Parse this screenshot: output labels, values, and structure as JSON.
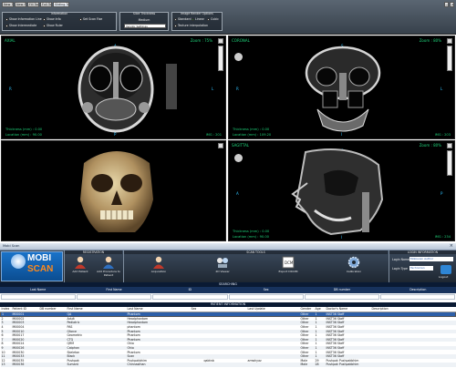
{
  "toolbar": {
    "buttons": [
      "New Tool",
      "New Pos",
      "Fill Tool",
      "Full Tool",
      "Sliding Tool"
    ],
    "information_title": "Information",
    "options": [
      "Show Information Line",
      "Show Info",
      "Set Scan Fixe",
      "Show Intermediate",
      "Show Ruler"
    ],
    "slice_thickness_title": "Slice Thickness",
    "slice_thickness_value": "Medium",
    "slice_thickness_select": "Vendor Settings",
    "image_render_title": "Image Render Options",
    "render_modes": [
      "Standard",
      "Linear",
      "Cubic"
    ],
    "texture_interp": "Texture interpolation"
  },
  "viewports": {
    "axial": {
      "label": "AXIAL",
      "zoom": "Zoom : 75%",
      "thickness": "Thickness (mm) : 0.00",
      "location": "Location (mm) : 90.00",
      "img": "IMG : 201",
      "orient_l": "R",
      "orient_t": "A",
      "orient_b": "P",
      "orient_r": "L"
    },
    "coronal": {
      "label": "CORONAL",
      "zoom": "Zoom : 80%",
      "thickness": "Thickness (mm) : 0.00",
      "location": "Location (mm) : 109.20",
      "img": "IMG : 203",
      "orient_l": "R",
      "orient_t": "S",
      "orient_b": "I",
      "orient_r": "L"
    },
    "sagittal": {
      "label": "SAGITTAL",
      "zoom": "Zoom : 80%",
      "thickness": "Thickness (mm) : 0.00",
      "location": "Location (mm) : 90.00",
      "img": "IMG : 234",
      "orient_l": "A",
      "orient_t": "S",
      "orient_b": "I",
      "orient_r": "P"
    }
  },
  "mobiscan": {
    "title_bar": "Mobi Scan",
    "logo_line1": "MOBI",
    "logo_line2": "SCAN",
    "registration_title": "REGISTRATION",
    "reg_items": [
      "Add Patient",
      "Add Procedure to Patient"
    ],
    "scan_tools_title": "SCAN TOOLS",
    "scan_items": [
      "Acquisition",
      "2D Viewer",
      "Export DICOM",
      "Calibration"
    ],
    "login_title": "LOGIN INFORMATION",
    "login_name_label": "Login Name",
    "login_name_value": "Mobiscan Author",
    "login_type_label": "Login Type",
    "login_type_value": "Technician",
    "logout_label": "Logout",
    "searching_title": "SEARCHING",
    "search_cols": [
      "Last Name",
      "First Name",
      "ID",
      "Sex",
      "DB number",
      "Description"
    ],
    "patient_info_title": "PATIENT INFORMATION",
    "table_headers": [
      "Index",
      "Patient ID",
      "DB number",
      "First Name",
      "Last Name",
      "Sex",
      "",
      "Last Update",
      "Gender",
      "Age",
      "Doctor's Name",
      "Description"
    ],
    "rows": [
      [
        "1",
        "M00001",
        "",
        "QA",
        "Phantom",
        "",
        "",
        "",
        "Other",
        "1",
        "INST36 Staff",
        ""
      ],
      [
        "2",
        "M00002",
        "",
        "Adult",
        "Headphantom",
        "",
        "",
        "",
        "Other",
        "1",
        "INST36 Staff",
        ""
      ],
      [
        "3",
        "M00003",
        "",
        "Pediatric",
        "Headphantom",
        "",
        "",
        "",
        "Other",
        "1",
        "INST36 Staff",
        ""
      ],
      [
        "4",
        "M00004",
        "",
        "PAS",
        "phantom",
        "",
        "",
        "",
        "Other",
        "1",
        "INST36 Staff",
        ""
      ],
      [
        "5",
        "M00010",
        "",
        "Gforce",
        "Phantom",
        "",
        "",
        "",
        "Other",
        "1",
        "INST36 Staff",
        ""
      ],
      [
        "6",
        "M00017",
        "",
        "Geometric",
        "Phantom",
        "",
        "",
        "",
        "Other",
        "1",
        "INST36 Staff",
        ""
      ],
      [
        "7",
        "M00020",
        "",
        "CTQ",
        "Phantom",
        "",
        "",
        "",
        "Other",
        "1",
        "INST36 Staff",
        ""
      ],
      [
        "8",
        "M00024",
        "",
        "QRM",
        "Ohio",
        "",
        "",
        "",
        "Other",
        "1",
        "INST36 Staff",
        ""
      ],
      [
        "9",
        "M00026",
        "",
        "Catphan",
        "Ohio",
        "",
        "",
        "",
        "Other",
        "1",
        "INST36 Staff",
        ""
      ],
      [
        "10",
        "M00030",
        "",
        "Skeleton",
        "Phantom",
        "",
        "",
        "",
        "Other",
        "1",
        "INST36 Staff",
        ""
      ],
      [
        "11",
        "M00033",
        "",
        "Black",
        "Scan",
        "",
        "",
        "",
        "Other",
        "1",
        "INST36 Staff",
        ""
      ],
      [
        "12",
        "M00035",
        "",
        "Pushpak",
        "Pushpakbhim",
        "",
        "qabtnb",
        "amwhyaz",
        "Male",
        "29",
        "Pushpak Pushpakbhim",
        ""
      ],
      [
        "13",
        "M00036",
        "",
        "Sumant",
        "Chinnasthan",
        "",
        "",
        "",
        "Male",
        "28",
        "Pushpak Pushpakbhim",
        ""
      ]
    ]
  }
}
